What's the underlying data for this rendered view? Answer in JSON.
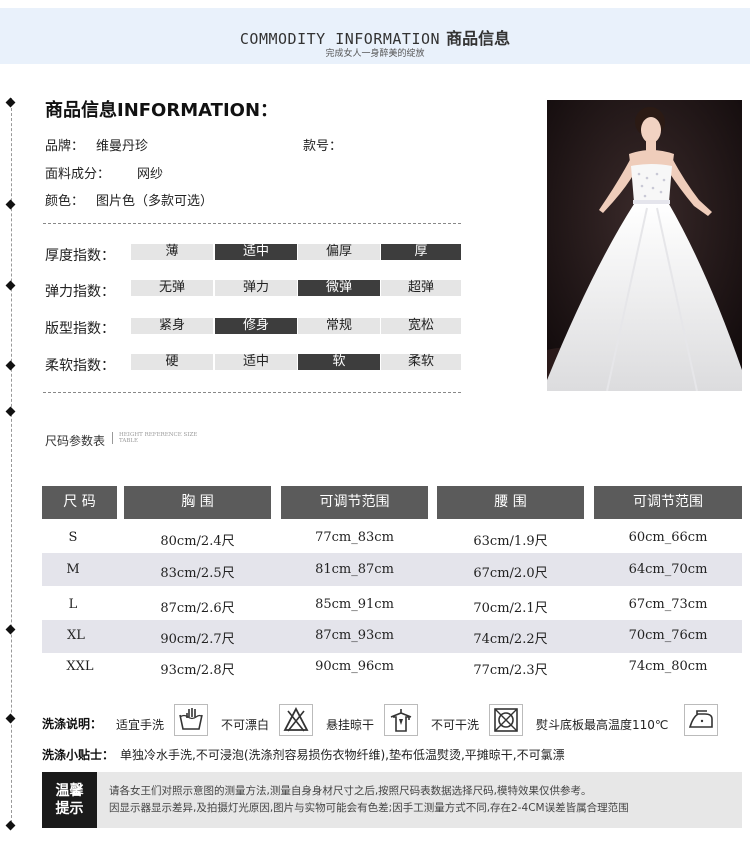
{
  "header": {
    "title_en": "COMMODITY INFORMATION",
    "title_cn": "商品信息",
    "subtitle": "完成女人一身醉美的绽放"
  },
  "info": {
    "title": "商品信息INFORMATION：",
    "brand_label": "品牌：",
    "brand_value": "维曼丹珍",
    "model_label": "款号：",
    "fabric_label": "面料成分：",
    "fabric_value": "网纱",
    "color_label": "颜色：",
    "color_value": "图片色（多款可选）"
  },
  "indices": [
    {
      "label": "厚度指数：",
      "options": [
        "薄",
        "适中",
        "偏厚",
        "厚"
      ],
      "selected": [
        1,
        3
      ]
    },
    {
      "label": "弹力指数：",
      "options": [
        "无弹",
        "弹力",
        "微弹",
        "超弹"
      ],
      "selected": [
        2
      ]
    },
    {
      "label": "版型指数：",
      "options": [
        "紧身",
        "修身",
        "常规",
        "宽松"
      ],
      "selected": [
        1
      ]
    },
    {
      "label": "柔软指数：",
      "options": [
        "硬",
        "适中",
        "软",
        "柔软"
      ],
      "selected": [
        2
      ]
    }
  ],
  "size_table": {
    "title": "尺码参数表",
    "subtitle": "HEIGHT REFERENCE SIZE TABLE",
    "headers": [
      "尺 码",
      "胸 围",
      "可调节范围",
      "腰 围",
      "可调节范围"
    ],
    "rows": [
      [
        "S",
        "80cm/2.4尺",
        "77cm_83cm",
        "63cm/1.9尺",
        "60cm_66cm"
      ],
      [
        "M",
        "83cm/2.5尺",
        "81cm_87cm",
        "67cm/2.0尺",
        "64cm_70cm"
      ],
      [
        "L",
        "87cm/2.6尺",
        "85cm_91cm",
        "70cm/2.1尺",
        "67cm_73cm"
      ],
      [
        "XL",
        "90cm/2.7尺",
        "87cm_93cm",
        "74cm/2.2尺",
        "70cm_76cm"
      ],
      [
        "XXL",
        "93cm/2.8尺",
        "90cm_96cm",
        "77cm/2.3尺",
        "74cm_80cm"
      ]
    ]
  },
  "care": {
    "label": "洗涤说明：",
    "items": [
      {
        "text": "适宜手洗",
        "icon": "hand-wash-icon"
      },
      {
        "text": "不可漂白",
        "icon": "no-bleach-icon"
      },
      {
        "text": "悬挂晾干",
        "icon": "hang-dry-icon"
      },
      {
        "text": "不可干洗",
        "icon": "no-dry-clean-icon"
      },
      {
        "text": "熨斗底板最高温度110℃",
        "icon": "iron-icon"
      }
    ],
    "tips_label": "洗涤小贴士：",
    "tips_text": "单独冷水手洗,不可浸泡(洗涤剂容易损伤衣物纤维),垫布低温熨烫,平摊晾干,不可氯漂"
  },
  "notice": {
    "badge_line1": "温馨",
    "badge_line2": "提示",
    "line1": "请各女王们对照示意图的测量方法,测量自身身材尺寸之后,按照尺码表数据选择尺码,模特效果仅供参考。",
    "line2": "因显示器显示差异,及拍摄灯光原因,图片与实物可能会有色差;因手工测量方式不同,存在2-4CM误差皆属合理范围"
  },
  "colors": {
    "banner": "#e9f1fb",
    "dark_cell": "#3d3d3d",
    "light_cell": "#e5e5e5",
    "header_cell": "#5b5b5b",
    "band": "#e4e4eb"
  }
}
